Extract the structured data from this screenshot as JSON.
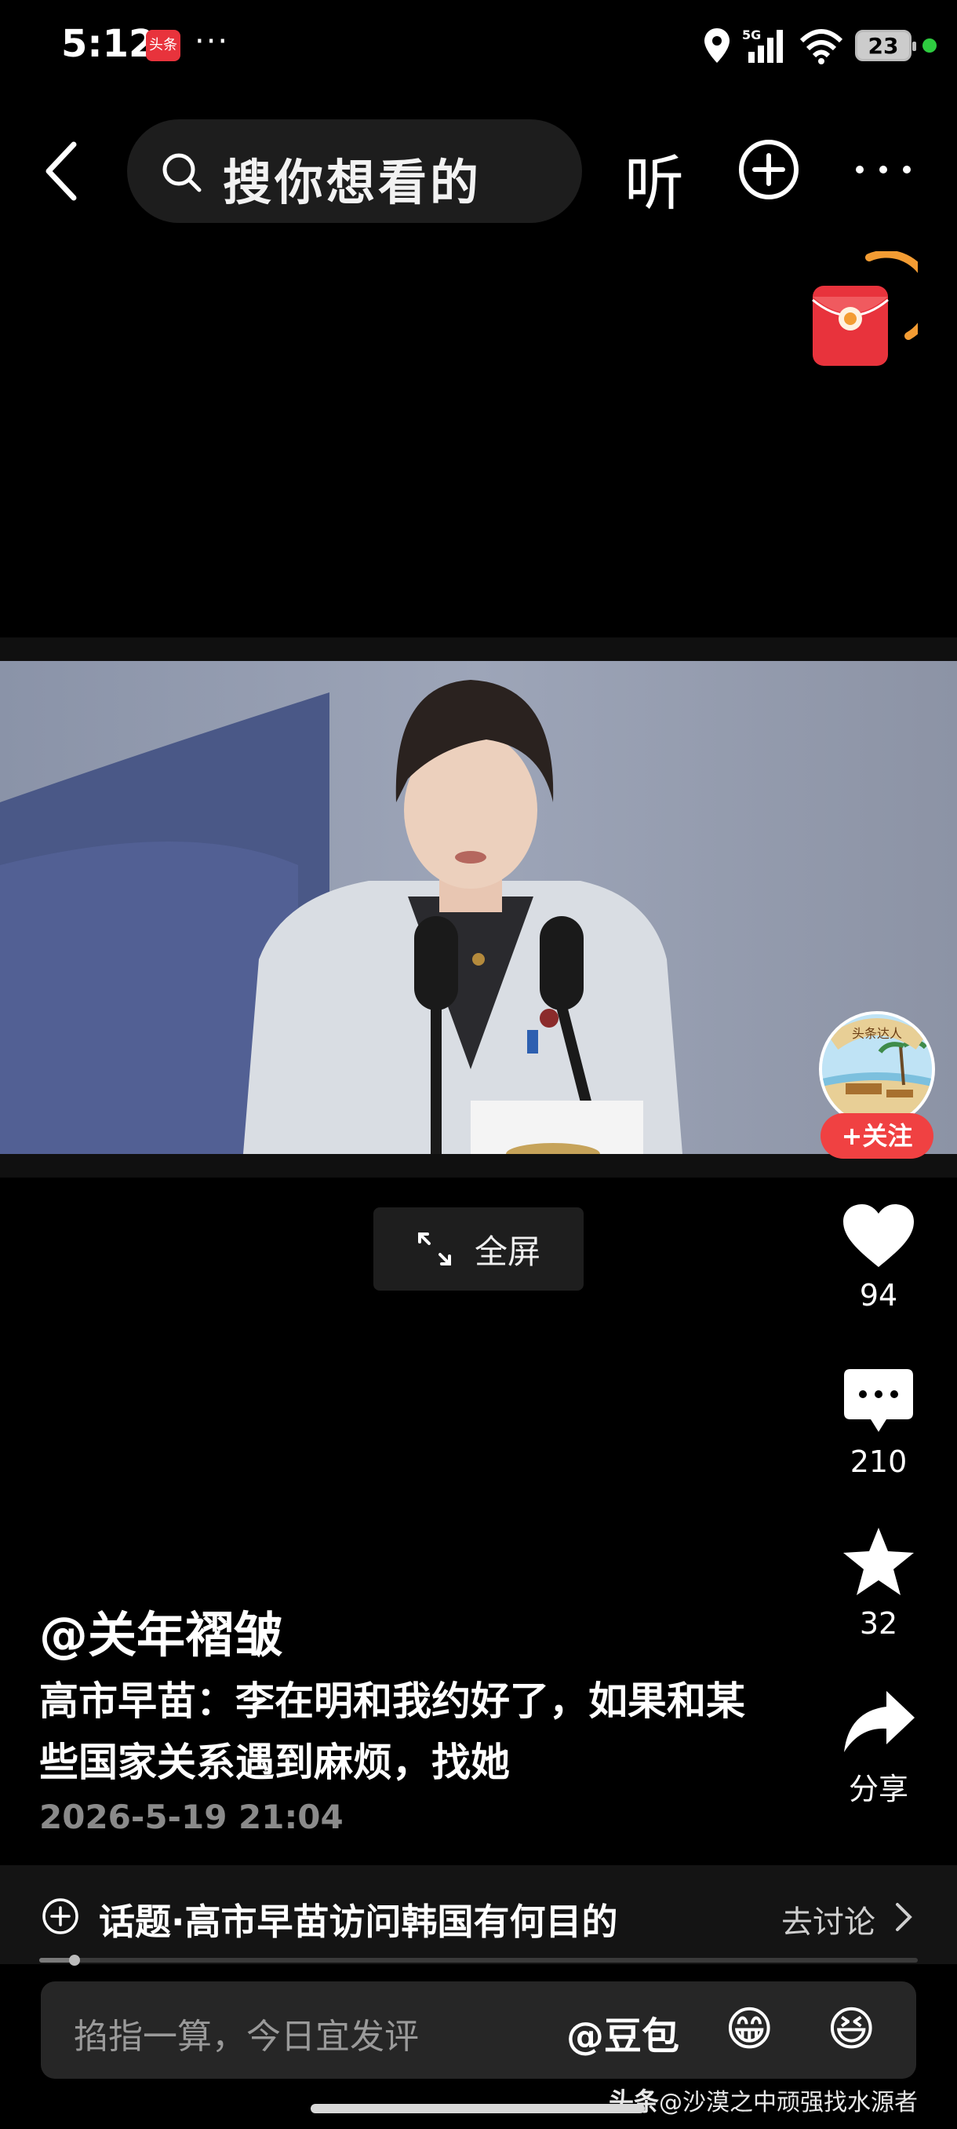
{
  "status_bar": {
    "time": "5:12",
    "app_badge": "头条",
    "more_dots": "···",
    "network": "5G",
    "battery": "23"
  },
  "top_bar": {
    "search_placeholder": "搜你想看的",
    "listen_label": "听"
  },
  "video": {
    "fullscreen_label": "全屏"
  },
  "author": {
    "follow_label": "+关注",
    "avatar_text": "头条达人",
    "name": "@关年褶皱"
  },
  "actions": {
    "like_count": "94",
    "comment_count": "210",
    "favorite_count": "32",
    "share_label": "分享"
  },
  "post": {
    "caption": "高市早苗：李在明和我约好了，如果和某些国家关系遇到麻烦，找她",
    "time": "2026-5-19 21:04"
  },
  "topic": {
    "label": "话题·高市早苗访问韩国有何目的",
    "discuss_label": "去讨论"
  },
  "progress": {
    "fraction": 0.04
  },
  "comment_bar": {
    "placeholder": "掐指一算，今日宜发评",
    "mention": "@豆包",
    "emoji_1": "😁",
    "emoji_2": "😆"
  },
  "watermark": {
    "brand": "头条",
    "handle": "@沙漠之中顽强找水源者"
  },
  "colors": {
    "background": "#000000",
    "accent_red": "#f04142",
    "muted_text": "#8a8a8a"
  }
}
